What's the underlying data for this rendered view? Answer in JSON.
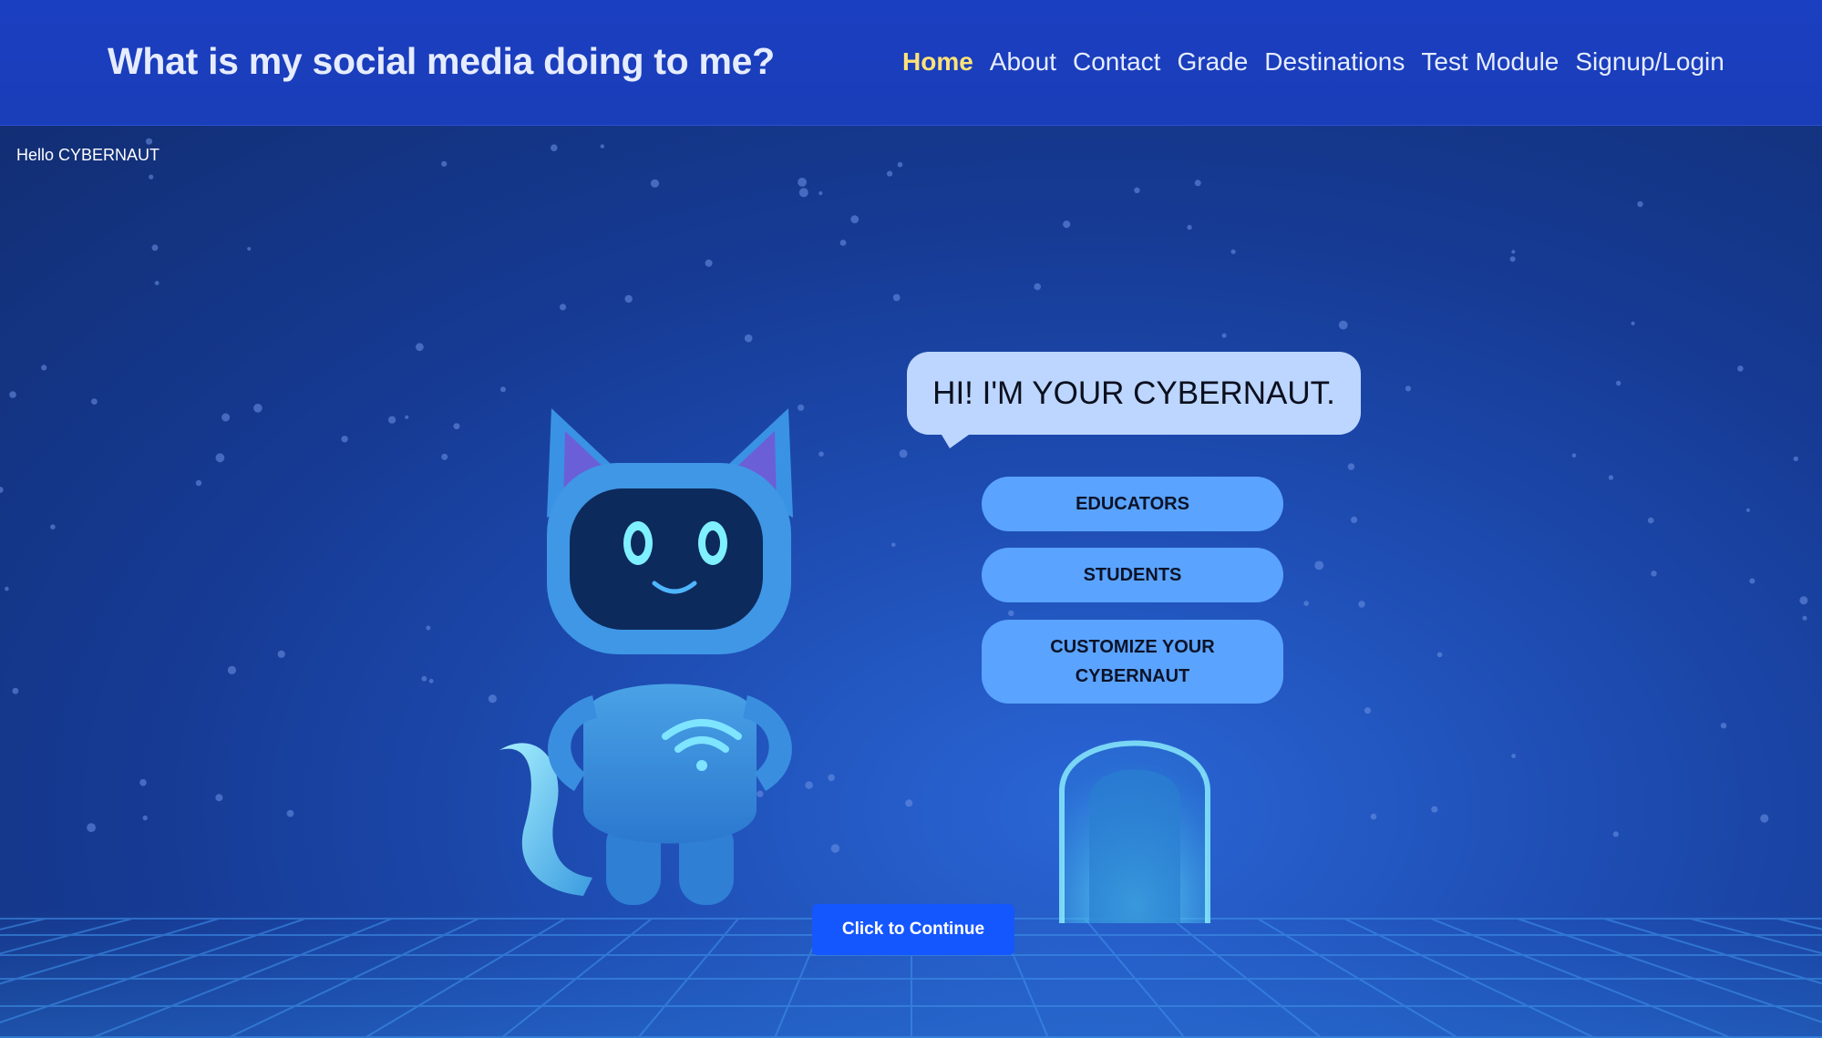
{
  "header": {
    "title": "What is my social media doing to me?",
    "nav": [
      {
        "label": "Home",
        "active": true
      },
      {
        "label": "About",
        "active": false
      },
      {
        "label": "Contact",
        "active": false
      },
      {
        "label": "Grade",
        "active": false
      },
      {
        "label": "Destinations",
        "active": false
      },
      {
        "label": "Test Module",
        "active": false
      },
      {
        "label": "Signup/Login",
        "active": false
      }
    ]
  },
  "main": {
    "greeting": "Hello CYBERNAUT",
    "speech_bubble": "HI! I'M YOUR CYBERNAUT.",
    "options": [
      {
        "label": "EDUCATORS"
      },
      {
        "label": "STUDENTS"
      },
      {
        "label": "CUSTOMIZE YOUR CYBERNAUT"
      }
    ],
    "continue_label": "Click to Continue"
  },
  "icons": {
    "mascot": "robot-cat-icon",
    "chest_symbol": "wifi-icon",
    "portal": "portal-arch-icon"
  },
  "colors": {
    "header_bg": "#1a3fc0",
    "active_nav": "#ffe27a",
    "option_button": "#5aa3ff",
    "continue_button": "#1557ff",
    "bubble": "#bcd6ff"
  }
}
